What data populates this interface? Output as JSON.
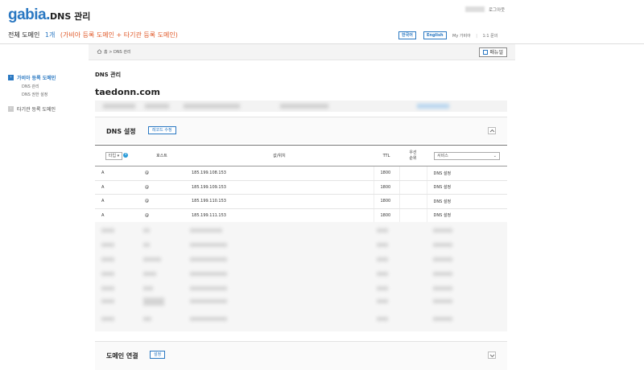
{
  "header": {
    "logo": "gabia.",
    "app_title": "DNS 관리",
    "logout": "로그아웃"
  },
  "summary": {
    "label": "전체 도메인",
    "count": "1개",
    "detail": "(가비아 등록 도메인 + 타기관 등록 도메인)"
  },
  "top_nav": {
    "lang_ko": "한국어",
    "lang_en": "English",
    "my_gabia": "My 가비아",
    "sep": "|",
    "support": "1:1 문의"
  },
  "breadcrumb": {
    "text": "홈 > DNS 관리"
  },
  "manual_button": "매뉴얼",
  "sidebar": {
    "gabia_domains": "가비아 등록 도메인",
    "dns_manage": "DNS 관리",
    "dns_perm": "DNS 권한 설정",
    "other_domains": "타기관 등록 도메인"
  },
  "main": {
    "heading": "DNS 관리",
    "domain": "taedonn.com"
  },
  "dns_section": {
    "title": "DNS 설정",
    "edit_button": "레코드 수정"
  },
  "table": {
    "headers": {
      "type": "타입",
      "host": "호스트",
      "value": "값/위치",
      "ttl": "TTL",
      "priority": "우선\n순위",
      "service": "서비스"
    },
    "rows": [
      {
        "type": "A",
        "host": "@",
        "value": "185.199.108.153",
        "ttl": "1800",
        "priority": "",
        "service": "DNS 설정"
      },
      {
        "type": "A",
        "host": "@",
        "value": "185.199.109.153",
        "ttl": "1800",
        "priority": "",
        "service": "DNS 설정"
      },
      {
        "type": "A",
        "host": "@",
        "value": "185.199.110.153",
        "ttl": "1800",
        "priority": "",
        "service": "DNS 설정"
      },
      {
        "type": "A",
        "host": "@",
        "value": "185.199.111.153",
        "ttl": "1800",
        "priority": "",
        "service": "DNS 설정"
      }
    ]
  },
  "connect_section": {
    "title": "도메인 연결",
    "settings_button": "설정"
  },
  "colors": {
    "accent": "#2a78c2",
    "highlight": "#e05a2a"
  }
}
